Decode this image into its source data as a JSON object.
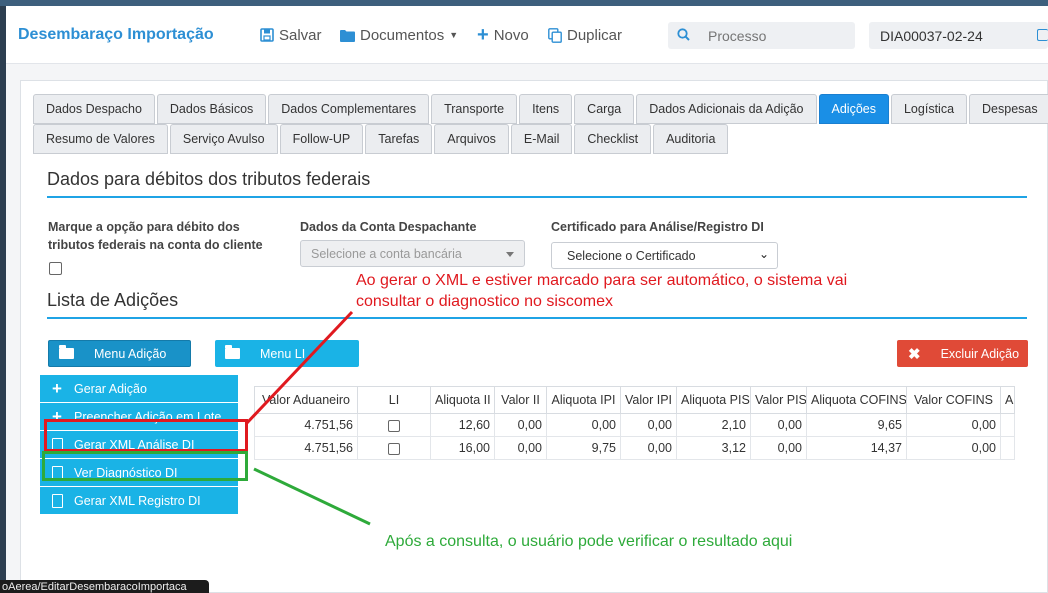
{
  "header": {
    "title": "Desembaraço Importação",
    "save_label": "Salvar",
    "documents_label": "Documentos",
    "new_label": "Novo",
    "duplicate_label": "Duplicar",
    "search_placeholder": "Processo",
    "process_code": "DIA00037-02-24"
  },
  "tabs_row1": [
    "Dados Despacho",
    "Dados Básicos",
    "Dados Complementares",
    "Transporte",
    "Itens",
    "Carga",
    "Dados Adicionais da Adição",
    "Adições",
    "Logística",
    "Despesas"
  ],
  "tabs_row2": [
    "Resumo de Valores",
    "Serviço Avulso",
    "Follow-UP",
    "Tarefas",
    "Arquivos",
    "E-Mail",
    "Checklist",
    "Auditoria"
  ],
  "active_tab": "Adições",
  "debits": {
    "title": "Dados para débitos dos tributos federais",
    "checkbox_label_line1": "Marque a opção para débito dos",
    "checkbox_label_line2": "tributos federais na conta do cliente",
    "account_label": "Dados da Conta Despachante",
    "account_placeholder": "Selecione a conta bancária",
    "cert_label": "Certificado para Análise/Registro DI",
    "cert_value": "Selecione o Certificado"
  },
  "additions": {
    "title": "Lista de Adições",
    "menu_adicao": "Menu Adição",
    "menu_li": "Menu LI",
    "excluir": "Excluir Adição",
    "menu_items": [
      "Gerar Adição",
      "Preencher Adição em Lote",
      "Gerar XML Análise DI",
      "Ver Diagnóstico DI",
      "Gerar XML Registro DI"
    ]
  },
  "table": {
    "headers": [
      "Valor Aduaneiro",
      "LI",
      "Aliquota II",
      "Valor II",
      "Aliquota IPI",
      "Valor IPI",
      "Aliquota PIS",
      "Valor PIS",
      "Aliquota COFINS",
      "Valor COFINS",
      "A"
    ],
    "rows": [
      [
        "4.751,56",
        "",
        "12,60",
        "0,00",
        "0,00",
        "0,00",
        "2,10",
        "0,00",
        "9,65",
        "0,00",
        ""
      ],
      [
        "4.751,56",
        "",
        "16,00",
        "0,00",
        "9,75",
        "0,00",
        "3,12",
        "0,00",
        "14,37",
        "0,00",
        ""
      ]
    ]
  },
  "annotations": {
    "red_note_line1": "Ao gerar o XML e estiver marcado para ser automático, o sistema vai",
    "red_note_line2": "consultar o diagnostico no siscomex",
    "green_note": "Após a consulta, o usuário pode verificar o resultado aqui",
    "red_color": "#e0191f",
    "green_color": "#2eaa3a"
  },
  "status_url": "oAerea/EditarDesembaracoImportaca"
}
